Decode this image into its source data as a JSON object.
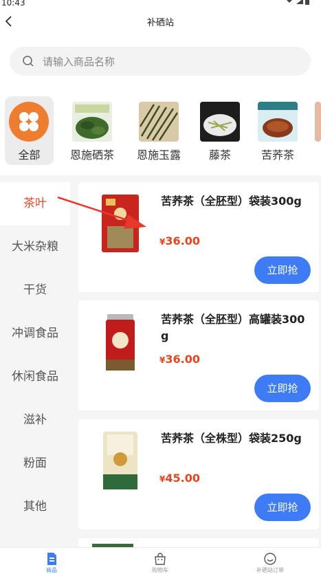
{
  "status": {
    "time": "10:43"
  },
  "header": {
    "title": "补硒站"
  },
  "search": {
    "placeholder": "请输入商品名称"
  },
  "categories": [
    {
      "label": "全部",
      "icon": "grid-icon"
    },
    {
      "label": "恩施硒茶"
    },
    {
      "label": "恩施玉露"
    },
    {
      "label": "藤茶"
    },
    {
      "label": "苦荞茶"
    }
  ],
  "sidebar": {
    "items": [
      {
        "label": "茶叶"
      },
      {
        "label": "大米杂粮"
      },
      {
        "label": "干货"
      },
      {
        "label": "冲调食品"
      },
      {
        "label": "休闲食品"
      },
      {
        "label": "滋补"
      },
      {
        "label": "粉面"
      },
      {
        "label": "其他"
      }
    ]
  },
  "products": [
    {
      "name": "苦荞茶（全胚型）袋装300g",
      "currency": "¥",
      "price": "36.00",
      "button": "立即抢"
    },
    {
      "name": "苦荞茶（全胚型）高罐装300g",
      "currency": "¥",
      "price": "36.00",
      "button": "立即抢"
    },
    {
      "name": "苦荞茶（全株型）袋装250g",
      "currency": "¥",
      "price": "45.00",
      "button": "立即抢"
    }
  ],
  "tabbar": {
    "items": [
      {
        "label": "商品",
        "icon": "document-icon"
      },
      {
        "label": "购物车",
        "icon": "bag-icon"
      },
      {
        "label": "补硒站订单",
        "icon": "smile-icon"
      }
    ]
  },
  "colors": {
    "accent": "#3e7cf5",
    "price": "#e8451e",
    "active_side": "#e84a27",
    "all_icon": "#ef7d2f"
  }
}
